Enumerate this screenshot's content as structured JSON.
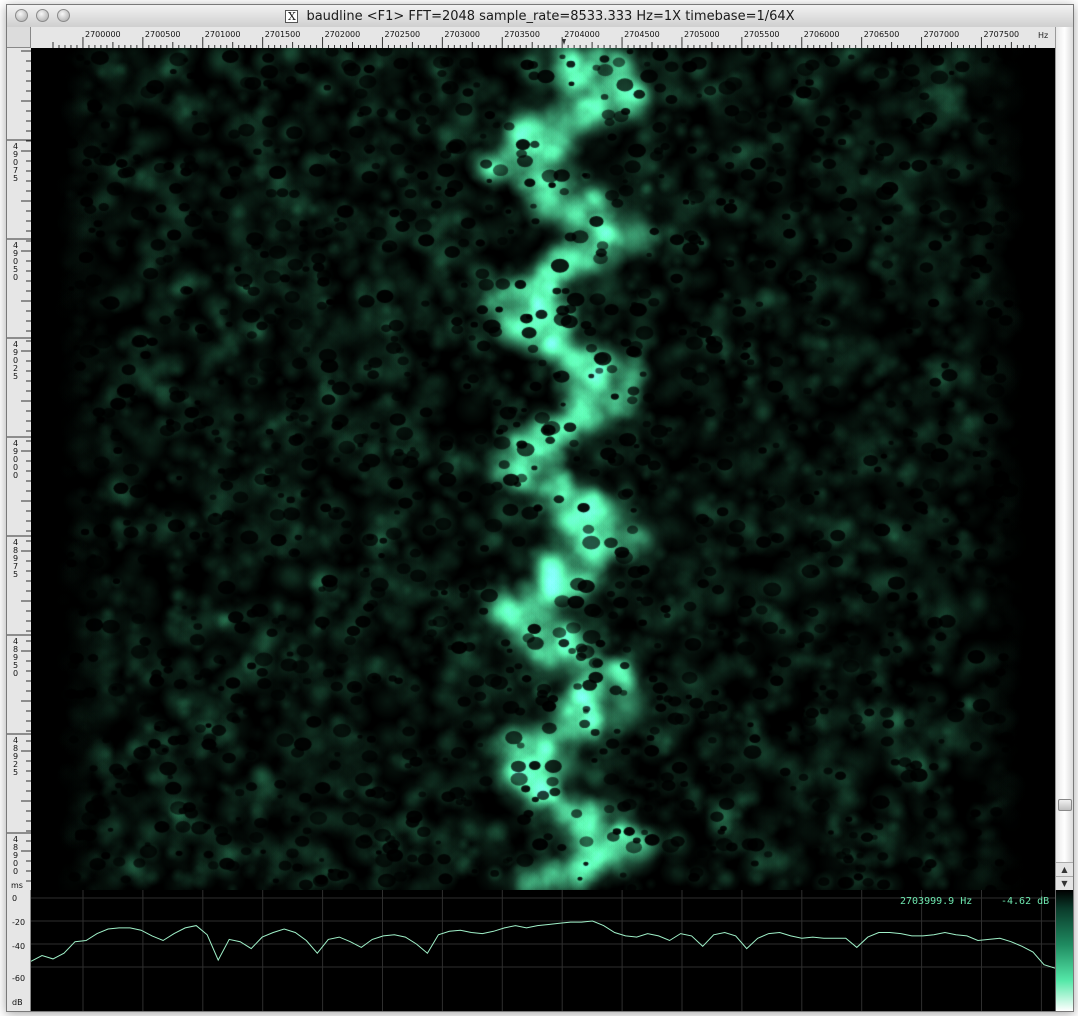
{
  "window": {
    "title": "baudline  <F1> FFT=2048 sample_rate=8533.333 Hz=1X timebase=1/64X"
  },
  "top_ruler": {
    "unit": "Hz",
    "labels": [
      "2700000",
      "2700500",
      "2701000",
      "2701500",
      "2702000",
      "2702500",
      "2703000",
      "2703500",
      "2704000",
      "2704500",
      "2705000",
      "2705500",
      "2706000",
      "2706500",
      "2707000",
      "2707500"
    ]
  },
  "left_ruler": {
    "labels": [
      "49075",
      "49050",
      "49025",
      "49000",
      "48975",
      "48950",
      "48925",
      "48900"
    ],
    "bottom_unit": "ms"
  },
  "spectrum": {
    "db_labels": [
      "0",
      "-20",
      "-40",
      "-60",
      "dB"
    ],
    "readout_frequency": "2703999.9 Hz",
    "readout_db": "-4.62 dB",
    "trace": [
      -55,
      -50,
      -53,
      -48,
      -38,
      -37,
      -31,
      -27,
      -26,
      -26,
      -28,
      -33,
      -37,
      -31,
      -26,
      -24,
      -32,
      -54,
      -36,
      -38,
      -44,
      -34,
      -30,
      -27,
      -30,
      -37,
      -48,
      -36,
      -34,
      -38,
      -43,
      -36,
      -33,
      -32,
      -34,
      -40,
      -48,
      -32,
      -29,
      -28,
      -30,
      -31,
      -29,
      -26,
      -24,
      -26,
      -24,
      -23,
      -22,
      -21,
      -21,
      -20,
      -24,
      -30,
      -33,
      -34,
      -31,
      -33,
      -37,
      -31,
      -33,
      -42,
      -32,
      -30,
      -33,
      -44,
      -35,
      -31,
      -30,
      -33,
      -35,
      -34,
      -35,
      -35,
      -35,
      -43,
      -34,
      -30,
      -30,
      -31,
      -33,
      -33,
      -32,
      -30,
      -32,
      -33,
      -37,
      -36,
      -35,
      -38,
      -42,
      -47,
      -58,
      -61
    ]
  },
  "colors": {
    "spectrogram_background": "#000000",
    "signal": "#4fe0a0",
    "trace": "#9ff0c8"
  },
  "icons": {
    "close": "close-button-icon",
    "minimize": "minimize-button-icon",
    "zoom": "zoom-button-icon",
    "x11": "x11-logo-icon"
  }
}
